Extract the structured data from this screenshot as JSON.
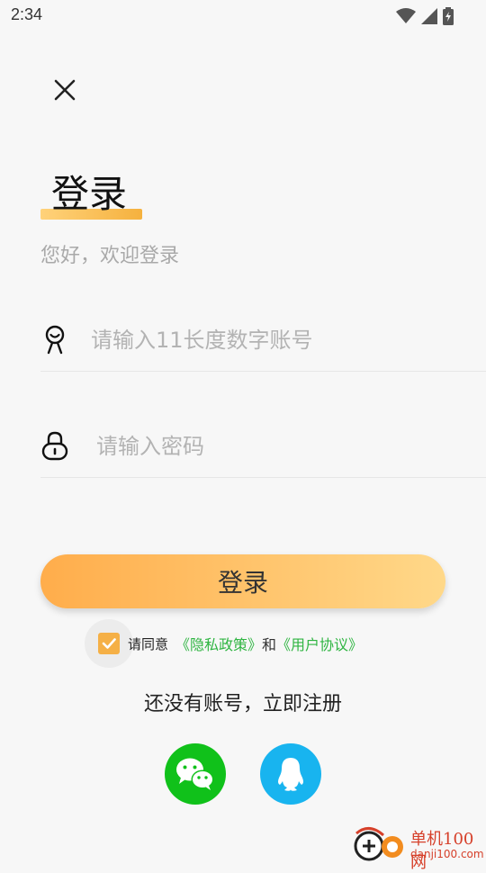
{
  "status_bar": {
    "time": "2:34"
  },
  "title": "登录",
  "subtitle": "您好，欢迎登录",
  "account_field": {
    "placeholder": "请输入11长度数字账号",
    "value": ""
  },
  "password_field": {
    "placeholder": "请输入密码",
    "value": ""
  },
  "login_button": "登录",
  "agreement": {
    "checked": true,
    "prefix": "请同意",
    "privacy_link": "《隐私政策》",
    "and": "和",
    "terms_link": "《用户协议》"
  },
  "register_text": "还没有账号，立即注册",
  "social": [
    {
      "name": "wechat",
      "icon": "wechat-icon",
      "color": "#10c11a"
    },
    {
      "name": "qq",
      "icon": "qq-icon",
      "color": "#18b4ef"
    }
  ],
  "colors": {
    "accent": "#f5b046",
    "link": "#2fb542"
  },
  "watermark": {
    "name": "单机100网",
    "url": "danji100.com"
  }
}
